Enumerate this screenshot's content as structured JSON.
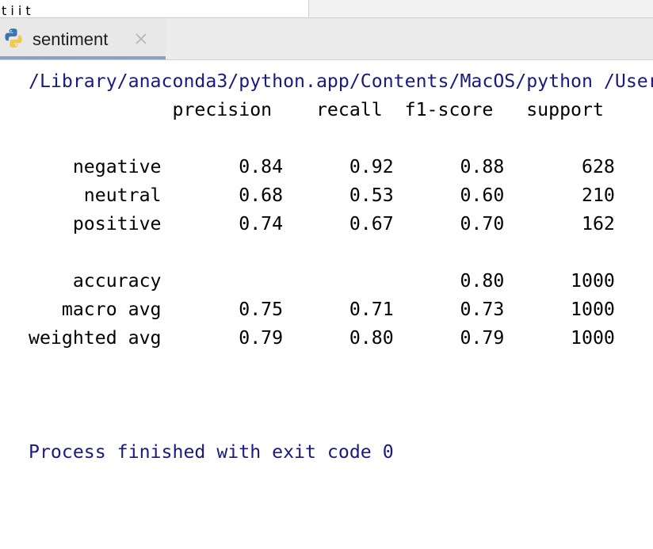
{
  "top_strip": {
    "cut_text": "t i i t"
  },
  "tab": {
    "label": "sentiment",
    "icon": "python-icon",
    "close_icon": "close-icon"
  },
  "console": {
    "command": "/Library/anaconda3/python.app/Contents/MacOS/python /Users",
    "report_lines": [
      "             precision    recall  f1-score   support",
      "",
      "    negative       0.84      0.92      0.88       628",
      "     neutral       0.68      0.53      0.60       210",
      "    positive       0.74      0.67      0.70       162",
      "",
      "    accuracy                           0.80      1000",
      "   macro avg       0.75      0.71      0.73      1000",
      "weighted avg       0.79      0.80      0.79      1000",
      "",
      "",
      ""
    ],
    "exit_message": "Process finished with exit code 0"
  },
  "colors": {
    "console_command": "#1a1a80",
    "tab_underline": "#8aa2c2",
    "background": "#ffffff"
  }
}
